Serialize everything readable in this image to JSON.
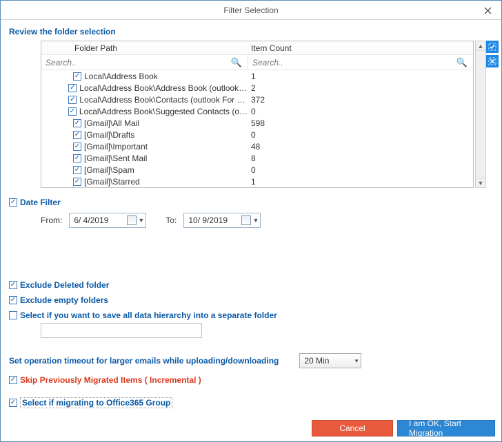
{
  "titlebar": {
    "title": "Filter Selection"
  },
  "heading": "Review the folder selection",
  "table": {
    "headers": {
      "folder": "Folder Path",
      "count": "Item Count"
    },
    "search_placeholder": "Search..",
    "rows": [
      {
        "checked": true,
        "indent": 3,
        "folder": "Local\\Address Book",
        "count": "1"
      },
      {
        "checked": true,
        "indent": 3,
        "folder": "Local\\Address Book\\Address Book (outlook For Mac ...",
        "count": "2"
      },
      {
        "checked": true,
        "indent": 3,
        "folder": "Local\\Address Book\\Contacts (outlook For Mac Archi...",
        "count": "372"
      },
      {
        "checked": true,
        "indent": 3,
        "folder": "Local\\Address Book\\Suggested Contacts (outlook For...",
        "count": "0"
      },
      {
        "checked": true,
        "indent": 3,
        "folder": "[Gmail]\\All Mail",
        "count": "598"
      },
      {
        "checked": true,
        "indent": 3,
        "folder": "[Gmail]\\Drafts",
        "count": "0"
      },
      {
        "checked": true,
        "indent": 3,
        "folder": "[Gmail]\\Important",
        "count": "48"
      },
      {
        "checked": true,
        "indent": 3,
        "folder": "[Gmail]\\Sent Mail",
        "count": "8"
      },
      {
        "checked": true,
        "indent": 3,
        "folder": "[Gmail]\\Spam",
        "count": "0"
      },
      {
        "checked": true,
        "indent": 3,
        "folder": "[Gmail]\\Starred",
        "count": "1"
      }
    ]
  },
  "date_filter": {
    "label": "Date Filter",
    "checked": true,
    "from_label": "From:",
    "from_value": " 6/  4/2019",
    "to_label": "To:",
    "to_value": "10/  9/2019"
  },
  "options": {
    "exclude_deleted": {
      "label": "Exclude Deleted folder",
      "checked": true
    },
    "exclude_empty": {
      "label": "Exclude empty folders",
      "checked": true
    },
    "save_hierarchy": {
      "label": "Select if you want to save all data hierarchy into a separate folder",
      "checked": false
    },
    "hierarchy_value": ""
  },
  "timeout": {
    "label": "Set operation timeout for larger emails while uploading/downloading",
    "value": "20 Min"
  },
  "skip_incremental": {
    "label": "Skip Previously Migrated Items ( Incremental )",
    "checked": true
  },
  "office365_group": {
    "label": "Select if migrating to Office365 Group",
    "checked": true
  },
  "buttons": {
    "cancel": "Cancel",
    "ok": "I am OK, Start Migration"
  }
}
